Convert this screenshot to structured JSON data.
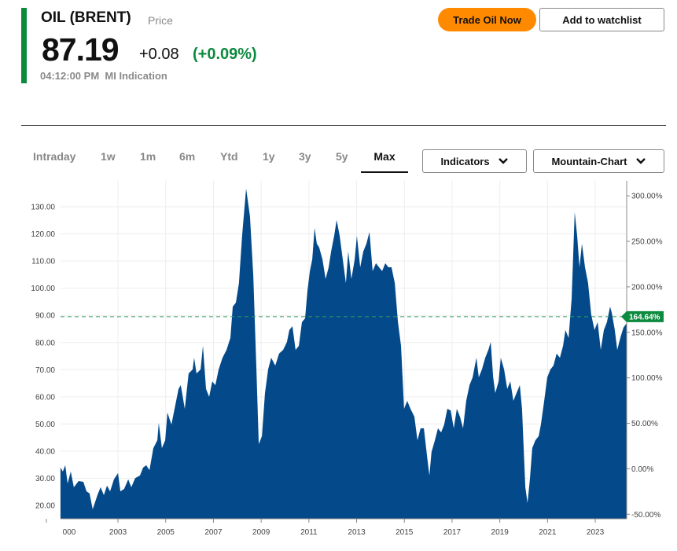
{
  "header": {
    "title": "OIL (BRENT)",
    "price_type": "Price",
    "price": "87.19",
    "change": "+0.08",
    "change_pct": "(+0.09%)",
    "time": "04:12:00 PM",
    "source": "MI Indication"
  },
  "buttons": {
    "trade": "Trade Oil Now",
    "watchlist": "Add to watchlist"
  },
  "tabs": [
    "Intraday",
    "1w",
    "1m",
    "6m",
    "Ytd",
    "1y",
    "3y",
    "5y",
    "Max"
  ],
  "active_tab": "Max",
  "dropdowns": {
    "indicators": "Indicators",
    "chart_type": "Mountain-Chart"
  },
  "colors": {
    "accent_green": "#0c8a3e",
    "area": "#044a8a",
    "orange": "#ff8a00"
  },
  "chart_data": {
    "type": "area",
    "xlim": [
      2000.0,
      2024.35
    ],
    "ylim": [
      15,
      138
    ],
    "x_ticks": [
      "000",
      "2003",
      "2005",
      "2007",
      "2009",
      "2011",
      "2013",
      "2015",
      "2017",
      "2019",
      "2021",
      "2023"
    ],
    "x_tick_values": [
      2000,
      2003,
      2005,
      2007,
      2009,
      2011,
      2013,
      2015,
      2017,
      2019,
      2021,
      2023
    ],
    "y_ticks": [
      "20.00",
      "30.00",
      "40.00",
      "50.00",
      "60.00",
      "70.00",
      "80.00",
      "90.00",
      "100.00",
      "110.00",
      "120.00",
      "130.00"
    ],
    "y_tick_values": [
      20,
      30,
      40,
      50,
      60,
      70,
      80,
      90,
      100,
      110,
      120,
      130
    ],
    "y2_ticks": [
      "-50.00%",
      "0.00%",
      "50.00%",
      "100.00%",
      "150.00%",
      "200.00%",
      "250.00%",
      "300.00%"
    ],
    "y2_tick_values": [
      -50,
      0,
      50,
      100,
      150,
      200,
      250,
      300
    ],
    "y2_base_price": 33.5,
    "last_label": "164.64%",
    "last_value": 87.19,
    "points": [
      [
        2000.59,
        34
      ],
      [
        2000.69,
        32.5
      ],
      [
        2000.79,
        34.8
      ],
      [
        2000.89,
        28.1
      ],
      [
        2001.02,
        32.5
      ],
      [
        2001.15,
        26.7
      ],
      [
        2001.35,
        29
      ],
      [
        2001.55,
        28.7
      ],
      [
        2001.68,
        25.2
      ],
      [
        2001.81,
        24.4
      ],
      [
        2001.94,
        18.6
      ],
      [
        2002.14,
        23.8
      ],
      [
        2002.27,
        26.7
      ],
      [
        2002.41,
        23.8
      ],
      [
        2002.54,
        27.3
      ],
      [
        2002.67,
        25.2
      ],
      [
        2002.83,
        29.6
      ],
      [
        2003.0,
        31.9
      ],
      [
        2003.1,
        25.2
      ],
      [
        2003.26,
        26.1
      ],
      [
        2003.43,
        29.6
      ],
      [
        2003.56,
        26.7
      ],
      [
        2003.72,
        30.1
      ],
      [
        2003.92,
        31
      ],
      [
        2004.05,
        33.9
      ],
      [
        2004.18,
        34.8
      ],
      [
        2004.32,
        33
      ],
      [
        2004.48,
        41.1
      ],
      [
        2004.65,
        44
      ],
      [
        2004.71,
        50.4
      ],
      [
        2004.84,
        41.1
      ],
      [
        2004.98,
        44
      ],
      [
        2005.07,
        54.2
      ],
      [
        2005.24,
        49.8
      ],
      [
        2005.37,
        55.6
      ],
      [
        2005.54,
        62.9
      ],
      [
        2005.63,
        64.3
      ],
      [
        2005.8,
        55.6
      ],
      [
        2005.96,
        68.6
      ],
      [
        2006.13,
        70.1
      ],
      [
        2006.19,
        74.4
      ],
      [
        2006.29,
        68.6
      ],
      [
        2006.46,
        70.1
      ],
      [
        2006.56,
        78.8
      ],
      [
        2006.69,
        62.9
      ],
      [
        2006.82,
        60
      ],
      [
        2006.95,
        65.7
      ],
      [
        2007.08,
        64.3
      ],
      [
        2007.22,
        70.1
      ],
      [
        2007.38,
        74.4
      ],
      [
        2007.55,
        77.3
      ],
      [
        2007.71,
        81.7
      ],
      [
        2007.81,
        93.2
      ],
      [
        2007.94,
        94.7
      ],
      [
        2008.07,
        101.9
      ],
      [
        2008.2,
        119.3
      ],
      [
        2008.37,
        136.7
      ],
      [
        2008.53,
        126.5
      ],
      [
        2008.67,
        104.8
      ],
      [
        2008.8,
        70.1
      ],
      [
        2008.9,
        42.6
      ],
      [
        2009.03,
        45.5
      ],
      [
        2009.16,
        61.4
      ],
      [
        2009.29,
        70.1
      ],
      [
        2009.42,
        74.4
      ],
      [
        2009.59,
        71.5
      ],
      [
        2009.75,
        75.9
      ],
      [
        2009.92,
        77.3
      ],
      [
        2010.08,
        80.2
      ],
      [
        2010.18,
        84.6
      ],
      [
        2010.31,
        86
      ],
      [
        2010.44,
        77.3
      ],
      [
        2010.58,
        78.8
      ],
      [
        2010.71,
        87.5
      ],
      [
        2010.84,
        88.9
      ],
      [
        2010.94,
        99
      ],
      [
        2011.04,
        106.3
      ],
      [
        2011.14,
        110.6
      ],
      [
        2011.24,
        122.2
      ],
      [
        2011.33,
        116.4
      ],
      [
        2011.43,
        115
      ],
      [
        2011.57,
        110.6
      ],
      [
        2011.7,
        103.4
      ],
      [
        2011.83,
        107.7
      ],
      [
        2011.93,
        113.5
      ],
      [
        2012.06,
        119.3
      ],
      [
        2012.16,
        125.1
      ],
      [
        2012.29,
        119.3
      ],
      [
        2012.42,
        110.6
      ],
      [
        2012.55,
        101.9
      ],
      [
        2012.65,
        113.5
      ],
      [
        2012.78,
        103.4
      ],
      [
        2012.92,
        110.6
      ],
      [
        2013.01,
        119.3
      ],
      [
        2013.15,
        107.7
      ],
      [
        2013.28,
        113.5
      ],
      [
        2013.41,
        116.4
      ],
      [
        2013.54,
        120.7
      ],
      [
        2013.67,
        106.3
      ],
      [
        2013.81,
        109.2
      ],
      [
        2013.94,
        107.7
      ],
      [
        2014.07,
        106.3
      ],
      [
        2014.2,
        109.2
      ],
      [
        2014.33,
        107.7
      ],
      [
        2014.46,
        107.7
      ],
      [
        2014.6,
        101.9
      ],
      [
        2014.73,
        87.5
      ],
      [
        2014.86,
        78.8
      ],
      [
        2014.99,
        55.6
      ],
      [
        2015.12,
        58.5
      ],
      [
        2015.26,
        55.6
      ],
      [
        2015.42,
        52.7
      ],
      [
        2015.55,
        44
      ],
      [
        2015.68,
        48.4
      ],
      [
        2015.82,
        48.4
      ],
      [
        2015.95,
        38.2
      ],
      [
        2016.05,
        31
      ],
      [
        2016.14,
        39.7
      ],
      [
        2016.28,
        44
      ],
      [
        2016.41,
        48.4
      ],
      [
        2016.54,
        46.9
      ],
      [
        2016.67,
        49.8
      ],
      [
        2016.8,
        55.6
      ],
      [
        2016.94,
        55
      ],
      [
        2017.07,
        48.4
      ],
      [
        2017.2,
        55.6
      ],
      [
        2017.33,
        52.7
      ],
      [
        2017.46,
        48.4
      ],
      [
        2017.59,
        58.5
      ],
      [
        2017.73,
        64.3
      ],
      [
        2017.86,
        67.2
      ],
      [
        2018.02,
        74.4
      ],
      [
        2018.12,
        67.2
      ],
      [
        2018.25,
        70.1
      ],
      [
        2018.39,
        74.4
      ],
      [
        2018.52,
        77.3
      ],
      [
        2018.62,
        80.2
      ],
      [
        2018.72,
        67.2
      ],
      [
        2018.81,
        61.4
      ],
      [
        2018.95,
        65.7
      ],
      [
        2019.04,
        74.4
      ],
      [
        2019.18,
        70.1
      ],
      [
        2019.31,
        62.9
      ],
      [
        2019.44,
        65.7
      ],
      [
        2019.57,
        58.5
      ],
      [
        2019.7,
        61.4
      ],
      [
        2019.84,
        64.3
      ],
      [
        2019.93,
        55.6
      ],
      [
        2020.07,
        26.7
      ],
      [
        2020.16,
        20.9
      ],
      [
        2020.26,
        29.6
      ],
      [
        2020.36,
        41.1
      ],
      [
        2020.49,
        44
      ],
      [
        2020.63,
        45.5
      ],
      [
        2020.72,
        49.8
      ],
      [
        2020.86,
        58.5
      ],
      [
        2020.99,
        67.2
      ],
      [
        2021.12,
        70.1
      ],
      [
        2021.25,
        71.5
      ],
      [
        2021.38,
        75.9
      ],
      [
        2021.52,
        74.4
      ],
      [
        2021.65,
        78.8
      ],
      [
        2021.75,
        84.6
      ],
      [
        2021.88,
        81.7
      ],
      [
        2022.01,
        96.1
      ],
      [
        2022.14,
        128
      ],
      [
        2022.24,
        119.3
      ],
      [
        2022.34,
        107.7
      ],
      [
        2022.44,
        116.4
      ],
      [
        2022.57,
        107.7
      ],
      [
        2022.7,
        101.9
      ],
      [
        2022.83,
        90.3
      ],
      [
        2022.97,
        84.6
      ],
      [
        2023.1,
        87.5
      ],
      [
        2023.23,
        77.3
      ],
      [
        2023.36,
        84.6
      ],
      [
        2023.49,
        87.5
      ],
      [
        2023.62,
        93.2
      ],
      [
        2023.69,
        91
      ],
      [
        2023.82,
        84.6
      ],
      [
        2023.92,
        77.3
      ],
      [
        2024.05,
        81.7
      ],
      [
        2024.18,
        85.5
      ],
      [
        2024.32,
        87.19
      ]
    ]
  }
}
